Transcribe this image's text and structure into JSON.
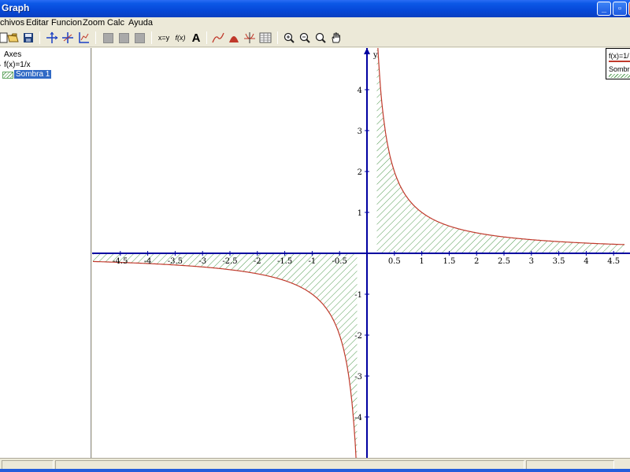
{
  "window": {
    "title": "Graph",
    "minimize_glyph": "_",
    "maximize_glyph": "▫",
    "close_glyph": "✕"
  },
  "menu": [
    "chivos",
    "Editar",
    "Funcion",
    "Zoom",
    "Calc",
    "Ayuda"
  ],
  "toolbar": {
    "swap_label": "x=y",
    "fx_label": "f(x)",
    "text_label": "A",
    "icons": [
      "open-folder-icon",
      "save-icon",
      "axes-cross-icon",
      "axes-arrows-icon",
      "coordinate-system-icon",
      "gray-square-icon",
      "gray-square-icon",
      "gray-square-icon",
      "swap-xy-icon",
      "insert-function-icon",
      "insert-text-icon",
      "curve-icon",
      "shading-icon",
      "tangent-icon",
      "table-icon",
      "zoom-in-icon",
      "zoom-out-icon",
      "zoom-fit-icon",
      "hand-pan-icon"
    ]
  },
  "tree": {
    "items": [
      "Axes",
      "f(x)=1/x",
      "Sombra 1"
    ],
    "selected": "Sombra 1"
  },
  "legend": {
    "function_label": "f(x)=1/",
    "shade_label": "Sombr"
  },
  "colors": {
    "axis": "#0000a0",
    "curve": "#c0392b",
    "shade": "#4f9a4f",
    "selection": "#316ac5"
  },
  "chart_data": {
    "type": "line",
    "function": "f(x)=1/x",
    "series": [
      {
        "name": "f(x)=1/x",
        "expression": "1/x"
      }
    ],
    "shading": {
      "name": "Sombra 1",
      "between": [
        "f(x)",
        "x-axis"
      ],
      "pattern": "diagonal-hatch"
    },
    "xlim": [
      -5,
      4.7
    ],
    "ylim": [
      -4.9,
      5
    ],
    "x_ticks": [
      -4.5,
      -4,
      -3.5,
      -3,
      -2.5,
      -2,
      -1.5,
      -1,
      -0.5,
      0.5,
      1,
      1.5,
      2,
      2.5,
      3,
      3.5,
      4,
      4.5
    ],
    "x_tick_labels": [
      "-4.5",
      "-4",
      "-3.5",
      "-3",
      "-2.5",
      "-2",
      "-1.5",
      "-1",
      "-0.5",
      "0.5",
      "1",
      "1.5",
      "2",
      "2.5",
      "3",
      "3.5",
      "4",
      "4.5"
    ],
    "y_ticks": [
      -4,
      -3,
      -2,
      -1,
      1,
      2,
      3,
      4
    ],
    "y_tick_labels": [
      "-4",
      "-3",
      "-2",
      "-1",
      "1",
      "2",
      "3",
      "4"
    ],
    "ylabel": "y",
    "grid": false
  }
}
